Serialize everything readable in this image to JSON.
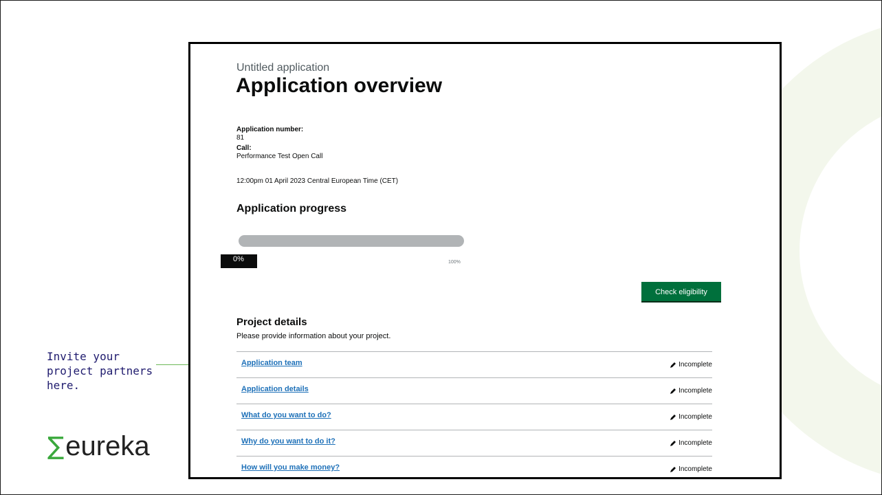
{
  "caption": {
    "lines": [
      "Invite your",
      "project partners",
      "here."
    ]
  },
  "logo": {
    "symbol": "∑",
    "text": "eureka"
  },
  "icons": {
    "status": "pencil-icon",
    "pointer": "arrow-icon",
    "logo_mark": "sigma-icon"
  },
  "colors": {
    "brand_green": "#00703c",
    "link_blue": "#1d70b8",
    "caption_ink": "#1f1b6e",
    "logo_green": "#3aa83c"
  },
  "app": {
    "subtitle": "Untitled application",
    "title": "Application overview",
    "application_number_label": "Application number:",
    "application_number": "81",
    "call_label": "Call:",
    "call_value": "Performance Test Open Call",
    "deadline": "12:00pm 01 April 2023 Central European Time (CET)",
    "progress_heading": "Application progress",
    "progress_percent": 0,
    "progress_label": "0%",
    "progress_max_label": "100%",
    "check_eligibility_label": "Check eligibility",
    "project_heading": "Project details",
    "project_description": "Please provide information about your project.",
    "tasks": [
      {
        "label": "Application team",
        "status": "Incomplete"
      },
      {
        "label": "Application details",
        "status": "Incomplete"
      },
      {
        "label": "What do you want to do?",
        "status": "Incomplete"
      },
      {
        "label": "Why do you want to do it?",
        "status": "Incomplete"
      },
      {
        "label": "How will you make money?",
        "status": "Incomplete"
      }
    ]
  }
}
